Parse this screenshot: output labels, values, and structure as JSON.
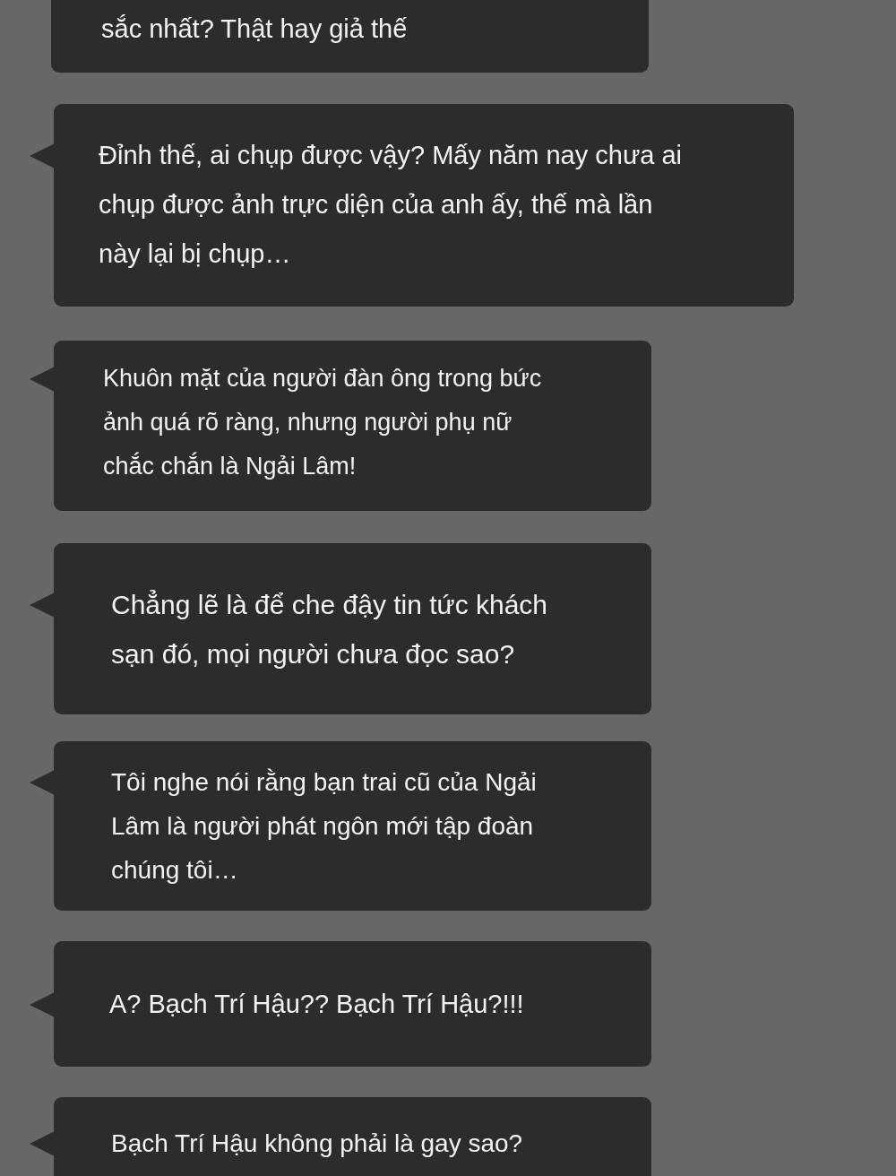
{
  "messages": [
    {
      "kind": "narrow",
      "cut_top": true,
      "lines": [
        "sắc nhất? Thật hay giả thế"
      ]
    },
    {
      "kind": "wide",
      "cut_top": false,
      "lines": [
        "Đỉnh thế, ai chụp được vậy? Mấy năm nay chưa ai",
        "chụp được ảnh trực diện của anh ấy, thế mà lần",
        "này lại bị chụp…"
      ]
    },
    {
      "kind": "narrow",
      "cut_top": false,
      "lines": [
        "Khuôn mặt của người đàn ông trong bức",
        "ảnh quá rõ ràng, nhưng người phụ nữ",
        "chắc chắn là Ngải Lâm!"
      ]
    },
    {
      "kind": "narrow",
      "cut_top": false,
      "lines": [
        "Chẳng lẽ là để che đậy tin tức khách",
        "sạn đó, mọi người chưa đọc sao?"
      ]
    },
    {
      "kind": "narrow",
      "cut_top": false,
      "lines": [
        "Tôi nghe nói rằng bạn trai cũ của Ngải",
        "Lâm là người phát ngôn mới tập đoàn",
        "chúng tôi…"
      ]
    },
    {
      "kind": "narrow",
      "cut_top": false,
      "lines": [
        "A? Bạch Trí Hậu?? Bạch Trí Hậu?!!!"
      ]
    },
    {
      "kind": "narrow",
      "cut_top": false,
      "lines": [
        "Bạch Trí Hậu không phải là gay sao?"
      ]
    }
  ]
}
